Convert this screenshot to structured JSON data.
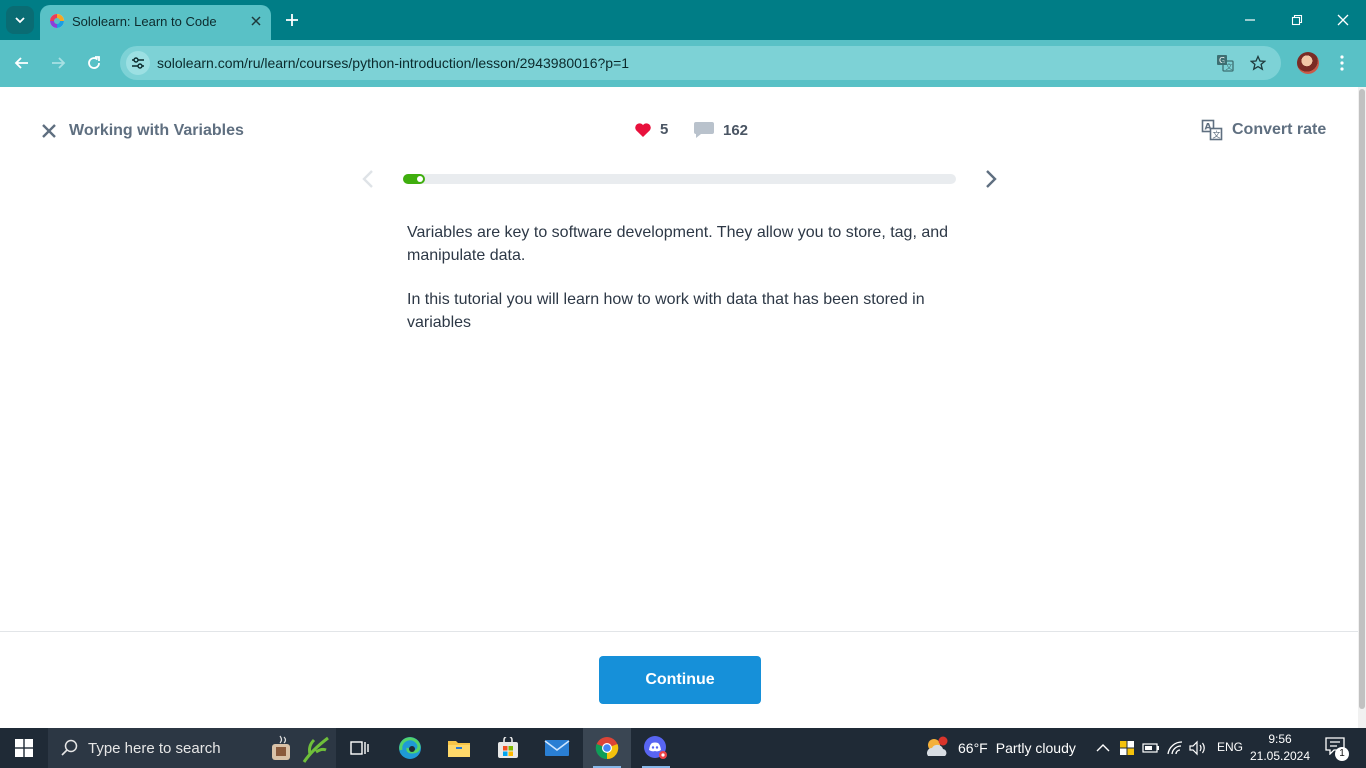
{
  "browser": {
    "tab": {
      "title": "Sololearn: Learn to Code",
      "favicon": "sololearn-logo-icon"
    },
    "url": "sololearn.com/ru/learn/courses/python-introduction/lesson/2943980016?p=1"
  },
  "lesson": {
    "title": "Working with Variables",
    "likes": "5",
    "comments": "162",
    "convert_label": "Convert rate",
    "progress_percent": 4,
    "paragraphs": [
      "Variables are key to software development. They allow you to store, tag, and manipulate data.",
      "In this tutorial you will learn how to work with data that has been stored in variables"
    ],
    "continue_label": "Continue"
  },
  "taskbar": {
    "search_placeholder": "Type here to search",
    "weather": {
      "temp": "66°F",
      "condition": "Partly cloudy",
      "alert_count": "1"
    },
    "language": "ENG",
    "time": "9:56",
    "date": "21.05.2024",
    "notification_count": "1"
  },
  "colors": {
    "accent_teal": "#59c1c6",
    "progress_green": "#3fae0e",
    "continue_blue": "#1690d9",
    "heart_red": "#e8113c"
  }
}
